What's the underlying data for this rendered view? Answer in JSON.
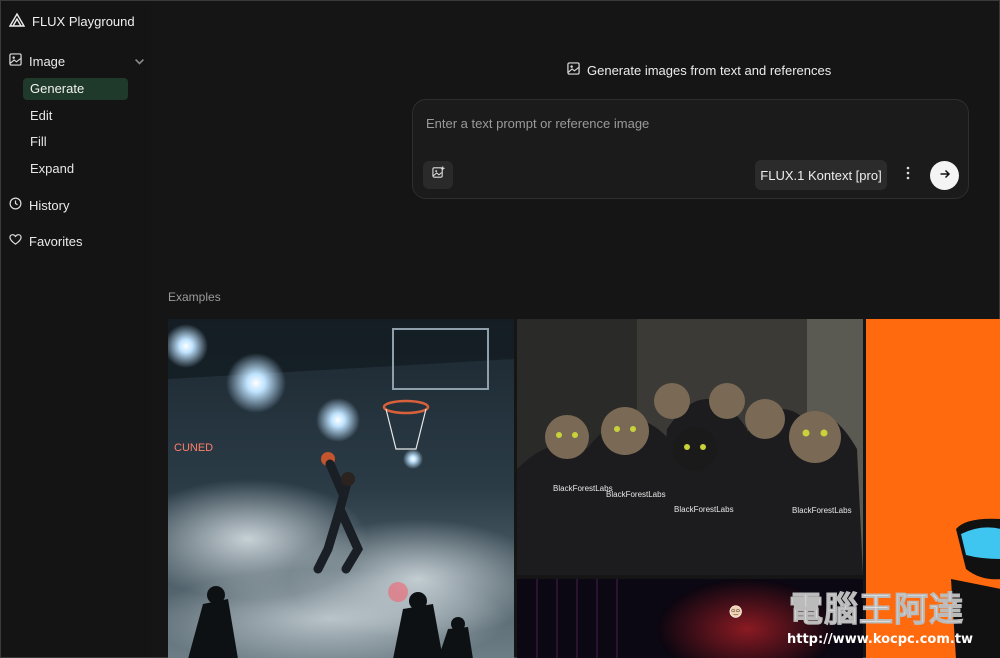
{
  "app": {
    "title": "FLUX Playground"
  },
  "sidebar": {
    "image_section": {
      "label": "Image"
    },
    "sub_items": [
      {
        "label": "Generate",
        "active": true
      },
      {
        "label": "Edit",
        "active": false
      },
      {
        "label": "Fill",
        "active": false
      },
      {
        "label": "Expand",
        "active": false
      }
    ],
    "history": {
      "label": "History"
    },
    "favorites": {
      "label": "Favorites"
    }
  },
  "main": {
    "heading": "Generate images from text and references",
    "prompt": {
      "placeholder": "Enter a text prompt or reference image",
      "value": ""
    },
    "model": "FLUX.1 Kontext [pro]",
    "examples_label": "Examples",
    "example_texts": [
      "CUNED",
      "BlackForestLabs",
      "BlackForestLabs",
      "BlackForestLabs",
      "BlackForestLabs"
    ]
  },
  "watermark": {
    "text": "電腦王阿達",
    "url": "http://www.kocpc.com.tw"
  },
  "colors": {
    "background": "#151515",
    "active_nav": "#1f3a2a",
    "accent_orange": "#ff6a0e",
    "send_button": "#f4f4f4"
  }
}
